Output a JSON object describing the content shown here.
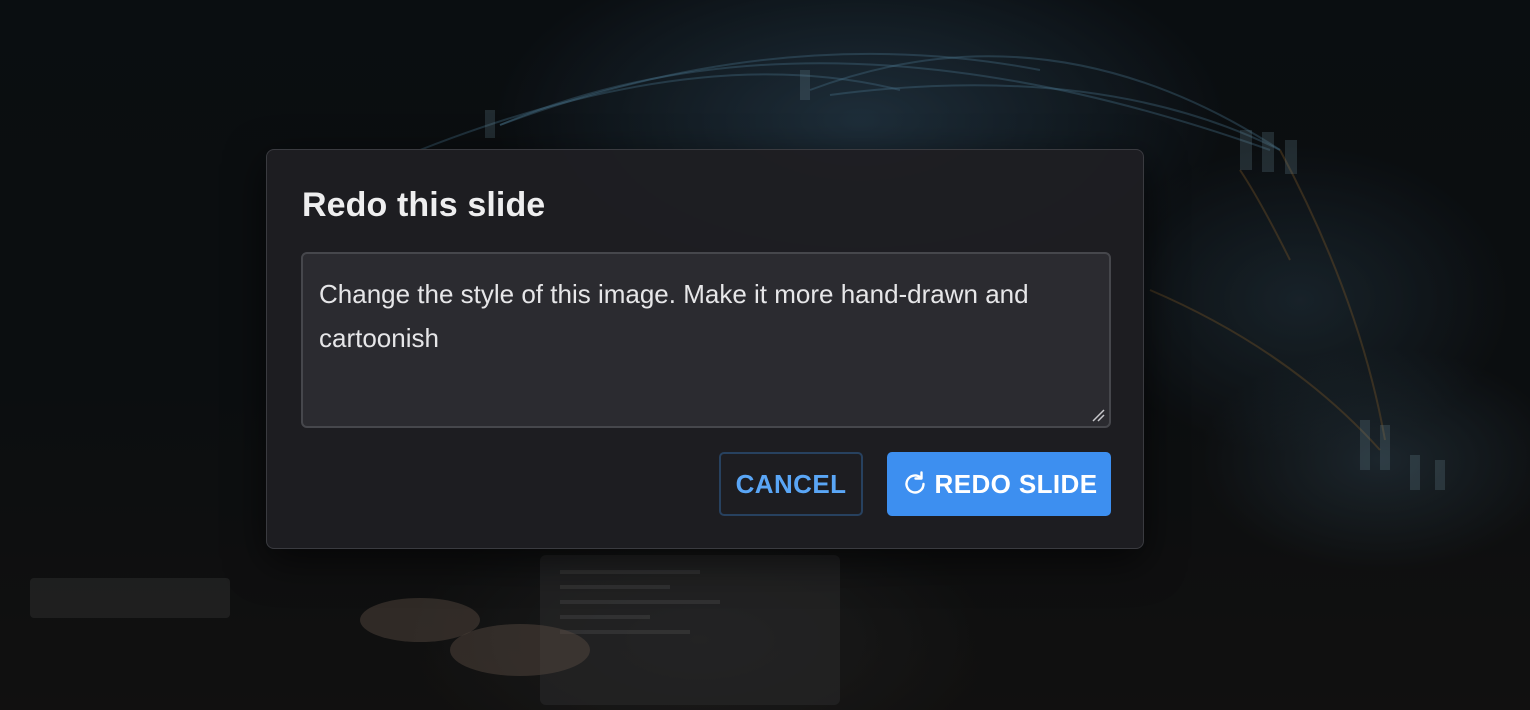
{
  "dialog": {
    "title": "Redo this slide",
    "prompt_value": "Change the style of this image. Make it more hand-drawn and cartoonish",
    "cancel_label": "CANCEL",
    "redo_label": "REDO SLIDE",
    "redo_icon": "refresh-icon"
  },
  "colors": {
    "accent": "#3d8ff0",
    "cancel_text": "#5aa6f6",
    "dialog_bg": "#1e1e22",
    "field_bg": "#2b2b30"
  }
}
